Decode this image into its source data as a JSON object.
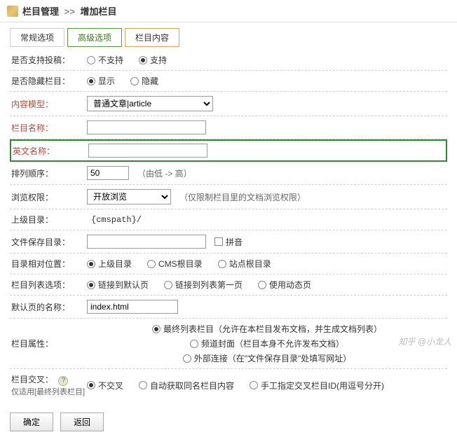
{
  "header": {
    "section": "栏目管理",
    "sep": ">>",
    "page": "增加栏目"
  },
  "tabs": {
    "t1": "常规选项",
    "t2": "高级选项",
    "t3": "栏目内容"
  },
  "rows": {
    "submit": {
      "label": "是否支持投稿：",
      "opt1": "不支持",
      "opt2": "支持"
    },
    "hidden": {
      "label": "是否隐藏栏目：",
      "opt1": "显示",
      "opt2": "隐藏"
    },
    "model": {
      "label": "内容模型：",
      "value": "普通文章|article"
    },
    "colname": {
      "label": "栏目名称："
    },
    "enname": {
      "label": "英文名称："
    },
    "sort": {
      "label": "排列顺序：",
      "value": "50",
      "hint": "（由低 -> 高）"
    },
    "browse": {
      "label": "浏览权限：",
      "value": "开放浏览",
      "hint": "（仅限制栏目里的文档浏览权限）"
    },
    "parent": {
      "label": "上级目录：",
      "value": "{cmspath}/"
    },
    "filesave": {
      "label": "文件保存目录：",
      "pinyin": "拼音"
    },
    "relpos": {
      "label": "目录相对位置：",
      "opt1": "上级目录",
      "opt2": "CMS根目录",
      "opt3": "站点根目录"
    },
    "listopt": {
      "label": "栏目列表选项：",
      "opt1": "链接到默认页",
      "opt2": "链接到列表第一页",
      "opt3": "使用动态页"
    },
    "defpage": {
      "label": "默认页的名称：",
      "value": "index.html"
    },
    "colattr": {
      "label": "栏目属性：",
      "opt1": "最终列表栏目（允许在本栏目发布文档，并生成文档列表）",
      "opt2": "频道封面（栏目本身不允许发布文档）",
      "opt3": "外部连接（在\"文件保存目录\"处填写网址）"
    },
    "cross": {
      "label": "栏目交叉：",
      "sub": "仅适用[最终列表栏目]",
      "opt1": "不交叉",
      "opt2": "自动获取同名栏目内容",
      "opt3": "手工指定交叉栏目ID(用逗号分开)"
    }
  },
  "buttons": {
    "ok": "确定",
    "back": "返回"
  },
  "watermark": "知乎 @小龙人",
  "help": "?"
}
